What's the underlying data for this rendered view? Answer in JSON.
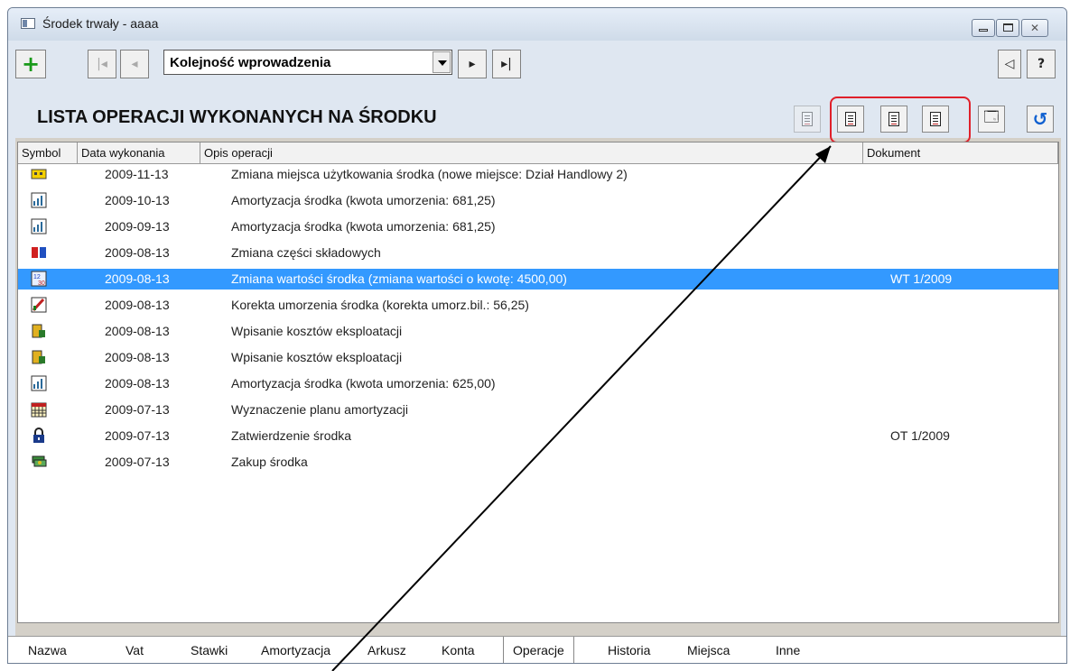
{
  "window": {
    "title": "Środek trwały - aaaa"
  },
  "toolbar": {
    "add_label": "+",
    "combo_value": "Kolejność wprowadzenia",
    "help_label": "?"
  },
  "header": {
    "title": "LISTA OPERACJI WYKONANYCH NA ŚRODKU"
  },
  "columns": {
    "symbol": "Symbol",
    "date": "Data wykonania",
    "desc": "Opis operacji",
    "doc": "Dokument"
  },
  "rows": [
    {
      "icon": "relocation-icon",
      "date": "2009-11-13",
      "desc": "Zmiana miejsca użytkowania środka (nowe miejsce: Dział Handlowy 2)",
      "doc": ""
    },
    {
      "icon": "depreciation-chart-icon",
      "date": "2009-10-13",
      "desc": "Amortyzacja środka (kwota umorzenia: 681,25)",
      "doc": ""
    },
    {
      "icon": "depreciation-chart-icon",
      "date": "2009-09-13",
      "desc": "Amortyzacja środka (kwota umorzenia: 681,25)",
      "doc": ""
    },
    {
      "icon": "components-icon",
      "date": "2009-08-13",
      "desc": "Zmiana części składowych",
      "doc": ""
    },
    {
      "icon": "value-change-icon",
      "date": "2009-08-13",
      "desc": "Zmiana wartości środka (zmiana wartości o kwotę: 4500,00)",
      "doc": "WT 1/2009"
    },
    {
      "icon": "correction-icon",
      "date": "2009-08-13",
      "desc": "Korekta umorzenia środka (korekta umorz.bil.: 56,25)",
      "doc": ""
    },
    {
      "icon": "costs-icon",
      "date": "2009-08-13",
      "desc": "Wpisanie kosztów eksploatacji",
      "doc": ""
    },
    {
      "icon": "costs-icon",
      "date": "2009-08-13",
      "desc": "Wpisanie kosztów eksploatacji",
      "doc": ""
    },
    {
      "icon": "depreciation-chart-icon",
      "date": "2009-08-13",
      "desc": "Amortyzacja środka (kwota umorzenia: 625,00)",
      "doc": ""
    },
    {
      "icon": "calendar-icon",
      "date": "2009-07-13",
      "desc": "Wyznaczenie planu amortyzacji",
      "doc": ""
    },
    {
      "icon": "lock-icon",
      "date": "2009-07-13",
      "desc": "Zatwierdzenie środka",
      "doc": "OT 1/2009"
    },
    {
      "icon": "money-icon",
      "date": "2009-07-13",
      "desc": "Zakup środka",
      "doc": ""
    }
  ],
  "selected_row": 4,
  "tabs": [
    {
      "label": "Nazwa"
    },
    {
      "label": "Vat"
    },
    {
      "label": "Stawki"
    },
    {
      "label": "Amortyzacja"
    },
    {
      "label": "Arkusz"
    },
    {
      "label": "Konta"
    },
    {
      "label": "Operacje",
      "active": true
    },
    {
      "label": "Historia"
    },
    {
      "label": "Miejsca"
    },
    {
      "label": "Inne"
    }
  ],
  "colors": {
    "selection": "#3399ff",
    "highlight_box": "#e0202a",
    "add_green": "#1a9a1a",
    "refresh_blue": "#1060d0"
  }
}
